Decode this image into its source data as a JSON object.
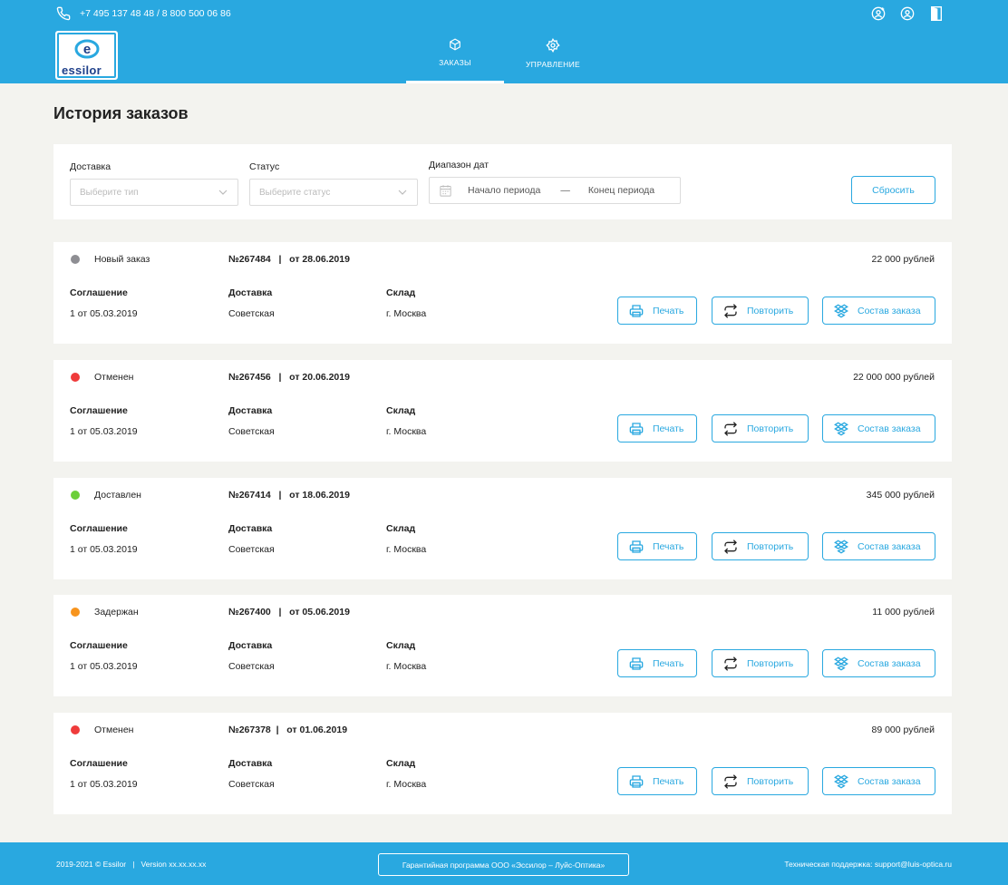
{
  "header": {
    "phone": "+7 495 137 48 48 / 8 800 500 06 86",
    "logo_text": "essilor",
    "nav": [
      {
        "label": "ЗАКАЗЫ",
        "icon": "box-icon",
        "active": true
      },
      {
        "label": "УПРАВЛЕНИЕ",
        "icon": "settings-icon",
        "active": false
      }
    ],
    "icons": [
      "add-user-icon",
      "account-icon",
      "logout-icon"
    ]
  },
  "page": {
    "title": "История заказов"
  },
  "filters": {
    "delivery_label": "Доставка",
    "delivery_placeholder": "Выберите тип",
    "status_label": "Статус",
    "status_placeholder": "Выберите статус",
    "date_label": "Диапазон дат",
    "date_start": "Начало периода",
    "date_sep": "—",
    "date_end": "Конец периода",
    "reset_label": "Сбросить"
  },
  "order_labels": {
    "agreement": "Соглашение",
    "delivery": "Доставка",
    "warehouse": "Склад",
    "print": "Печать",
    "repeat": "Повторить",
    "composition": "Состав заказа"
  },
  "orders": [
    {
      "status": "Новый заказ",
      "status_color": "#8e8e93",
      "number": "№267484   |   от 28.06.2019",
      "sum": "22 000 рублей",
      "agreement": "1 от 05.03.2019",
      "delivery": "Советская",
      "warehouse": "г. Москва"
    },
    {
      "status": "Отменен",
      "status_color": "#ef3b3b",
      "number": "№267456   |   от 20.06.2019",
      "sum": "22 000 000 рублей",
      "agreement": "1 от 05.03.2019",
      "delivery": "Советская",
      "warehouse": "г. Москва"
    },
    {
      "status": "Доставлен",
      "status_color": "#6ccf3a",
      "number": "№267414   |   от 18.06.2019",
      "sum": "345 000 рублей",
      "agreement": "1 от 05.03.2019",
      "delivery": "Советская",
      "warehouse": "г. Москва"
    },
    {
      "status": "Задержан",
      "status_color": "#f7941d",
      "number": "№267400   |   от 05.06.2019",
      "sum": "11 000 рублей",
      "agreement": "1 от 05.03.2019",
      "delivery": "Советская",
      "warehouse": "г. Москва"
    },
    {
      "status": "Отменен",
      "status_color": "#ef3b3b",
      "number": "№267378  |   от 01.06.2019",
      "sum": "89 000 рублей",
      "agreement": "1 от 05.03.2019",
      "delivery": "Советская",
      "warehouse": "г. Москва"
    }
  ],
  "footer": {
    "copyright": "2019-2021 © Essilor   |   Version xx.xx.xx.xx",
    "guarantee": "Гарантийная программа ООО «Эссилор – Луйс-Оптика»",
    "support": "Техническая поддержка: support@luis-optica.ru"
  },
  "colors": {
    "accent": "#29a8e0",
    "background": "#f3f3ef"
  }
}
